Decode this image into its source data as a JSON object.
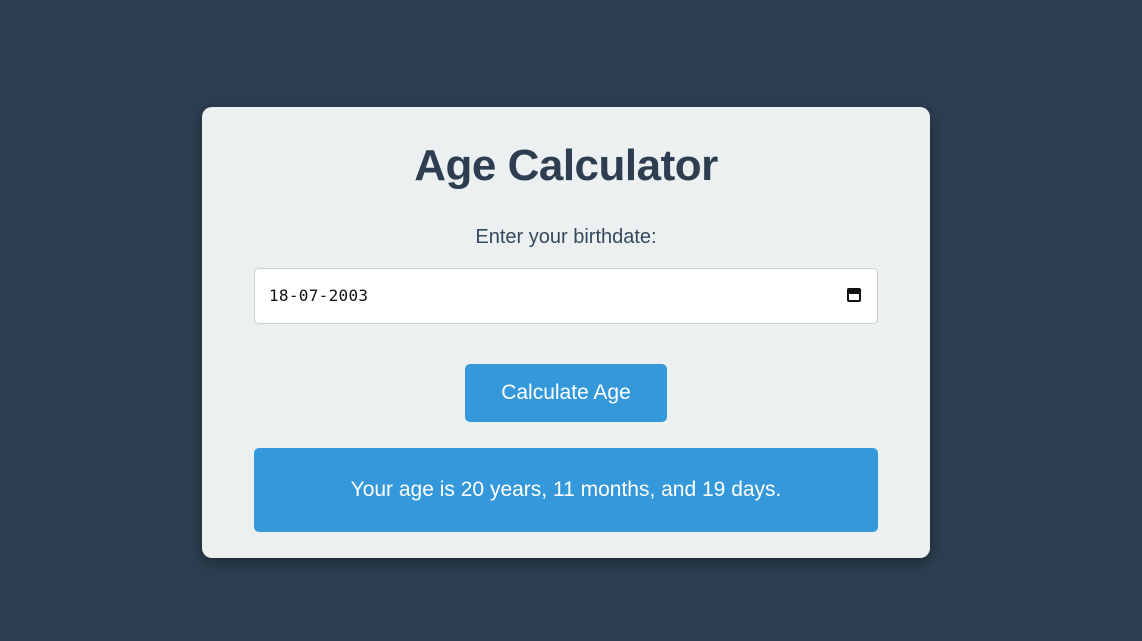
{
  "card": {
    "title": "Age Calculator",
    "birthdate_label": "Enter your birthdate:",
    "birthdate_value": "18-07-2003",
    "calculate_button_label": "Calculate Age",
    "result_text": "Your age is 20 years, 11 months, and 19 days."
  },
  "colors": {
    "page_background": "#2c3e50",
    "card_background": "#ecf0f1",
    "accent": "#3498db",
    "title_text": "#2c3e50"
  },
  "icons": {
    "date_picker": "calendar-icon"
  }
}
